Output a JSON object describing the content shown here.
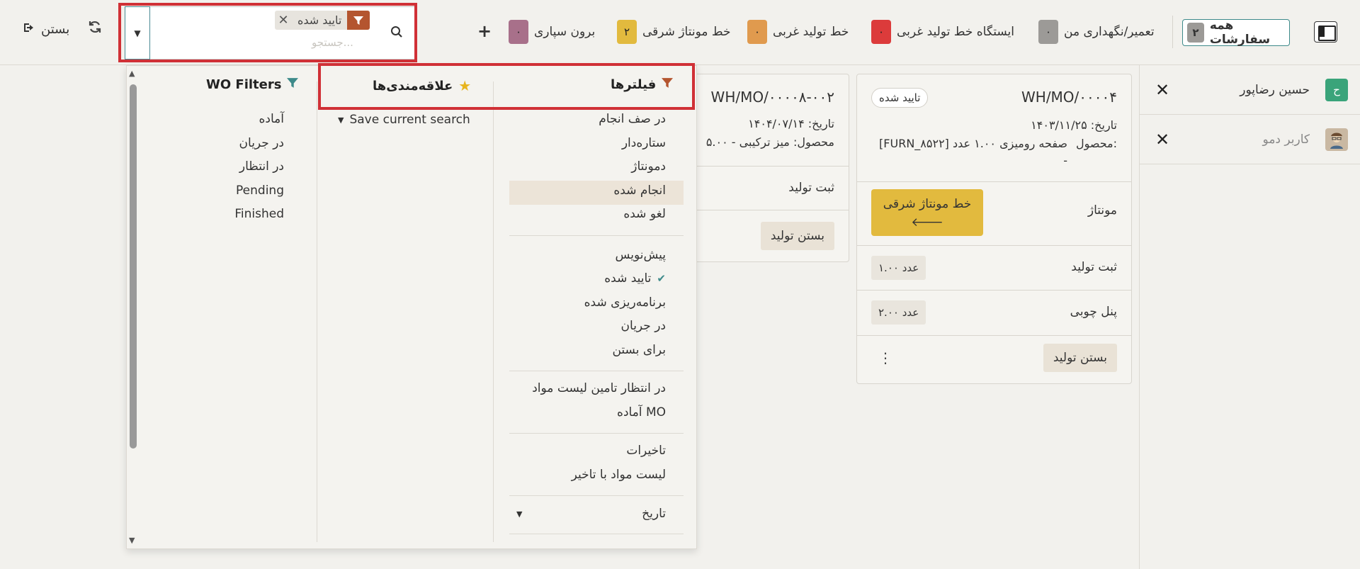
{
  "topbar": {
    "exit_label": "بستن",
    "search_facet": "تایید شده",
    "search_placeholder": "جستجو...",
    "chips": [
      {
        "label": "برون سپاری",
        "count": "۰",
        "color": "#a8708a"
      },
      {
        "label": "خط مونتاژ شرقی",
        "count": "۲",
        "color": "#e2ba3e"
      },
      {
        "label": "خط تولید غربی",
        "count": "۰",
        "color": "#e09a4e"
      },
      {
        "label": "ایستگاه خط تولید غربی",
        "count": "۰",
        "color": "#dc3b3b"
      },
      {
        "label": "تعمیر/نگهداری من",
        "count": "۰",
        "color": "#9c9a97"
      }
    ],
    "all_orders": {
      "label": "همه سفارشات",
      "count": "۲"
    }
  },
  "users": [
    {
      "name": "حسین رضاپور",
      "initial": "ح",
      "avatar_color": "#3aa47a"
    },
    {
      "name": "کاربر دمو",
      "initial": "",
      "avatar_color": "#c9b8a2"
    }
  ],
  "card1": {
    "name": "WH/MO/۰۰۰۰۴",
    "state": "تایید شده",
    "date": "تاریخ: ۱۴۰۳/۱۱/۲۵",
    "product_label": "محصول:",
    "product": "[FURN_۸۵۲۲] صفحه رومیزی ۱.۰۰ عدد",
    "product_dash": "-",
    "rows": [
      {
        "label": "مونتاژ",
        "station": "خط مونتاژ شرقی"
      },
      {
        "label": "ثبت تولید",
        "qty": "۱.۰۰ عدد"
      },
      {
        "label": "پنل چوبی",
        "qty": "۲.۰۰ عدد"
      }
    ],
    "close_label": "بستن تولید"
  },
  "card2": {
    "name": "WH/MO/۰۰۰۰۸-۰۰۲",
    "date": "تاریخ: ۱۴۰۴/۰۷/۱۴",
    "product": "محصول:  میز ترکیبی - ۵.۰۰",
    "row_label": "ثبت تولید",
    "close_label": "بستن تولید"
  },
  "dropdown": {
    "filters_title": "فیلترها",
    "favorites_title": "علاقه‌مندی‌ها",
    "wo_title": "WO Filters",
    "save_search": "Save current search",
    "filters": [
      "در صف انجام",
      "ستاره‌دار",
      "دمونتاژ",
      "انجام شده",
      "لغو شده",
      "پیش‌نویس",
      "تایید شده",
      "برنامه‌ریزی شده",
      "در جریان",
      "برای بستن",
      "در انتظار تامین لیست مواد",
      "آماده MO",
      "تاخیرات",
      "لیست مواد با تاخیر",
      "تاریخ"
    ],
    "wo_filters": [
      "آماده",
      "در جریان",
      "در انتظار",
      "Pending",
      "Finished"
    ]
  }
}
